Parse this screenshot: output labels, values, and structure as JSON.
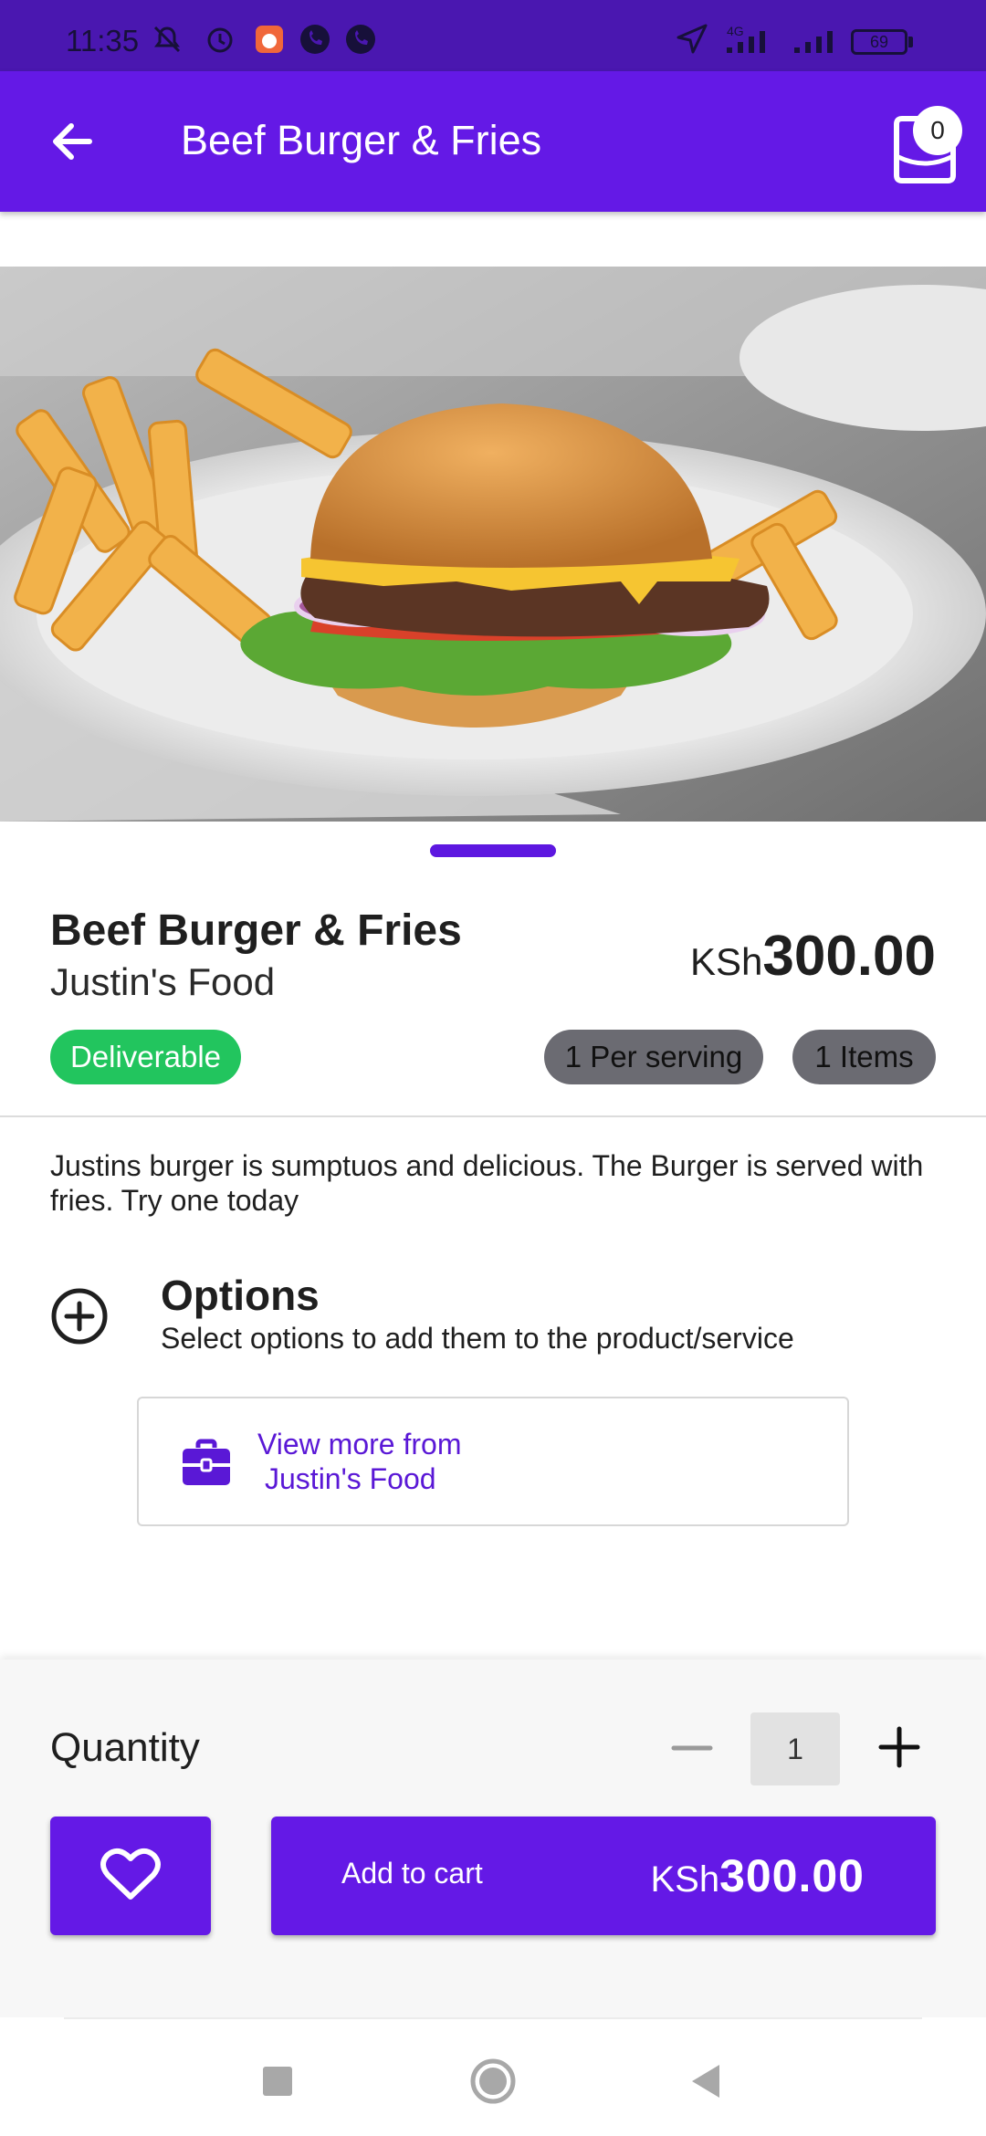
{
  "status_bar": {
    "time": "11:35",
    "network": "4G",
    "battery": "69"
  },
  "app_bar": {
    "title": "Beef Burger & Fries",
    "back_icon": "arrow-left-icon",
    "cart_icon": "shopping-bag-icon",
    "cart_count": "0"
  },
  "product": {
    "name": "Beef Burger & Fries",
    "vendor": "Justin's Food",
    "price_currency": "KSh",
    "price_amount": "300.00",
    "badges": {
      "deliverable": "Deliverable",
      "per_serving": "1 Per serving",
      "items": "1 Items"
    },
    "description": "Justins burger is sumptuos and delicious. The Burger is served with fries. Try one today"
  },
  "options": {
    "title": "Options",
    "subtitle": "Select options to add them to the product/service"
  },
  "view_more": {
    "line1": "View more from",
    "line2": "Justin's Food"
  },
  "quantity": {
    "label": "Quantity",
    "value": "1"
  },
  "add_to_cart": {
    "label": "Add to cart",
    "currency": "KSh",
    "amount": "300.00"
  },
  "colors": {
    "primary": "#6419e6",
    "status_bar": "#4a17b0",
    "deliverable": "#22c55e",
    "chip_gray": "#6b6b72"
  }
}
